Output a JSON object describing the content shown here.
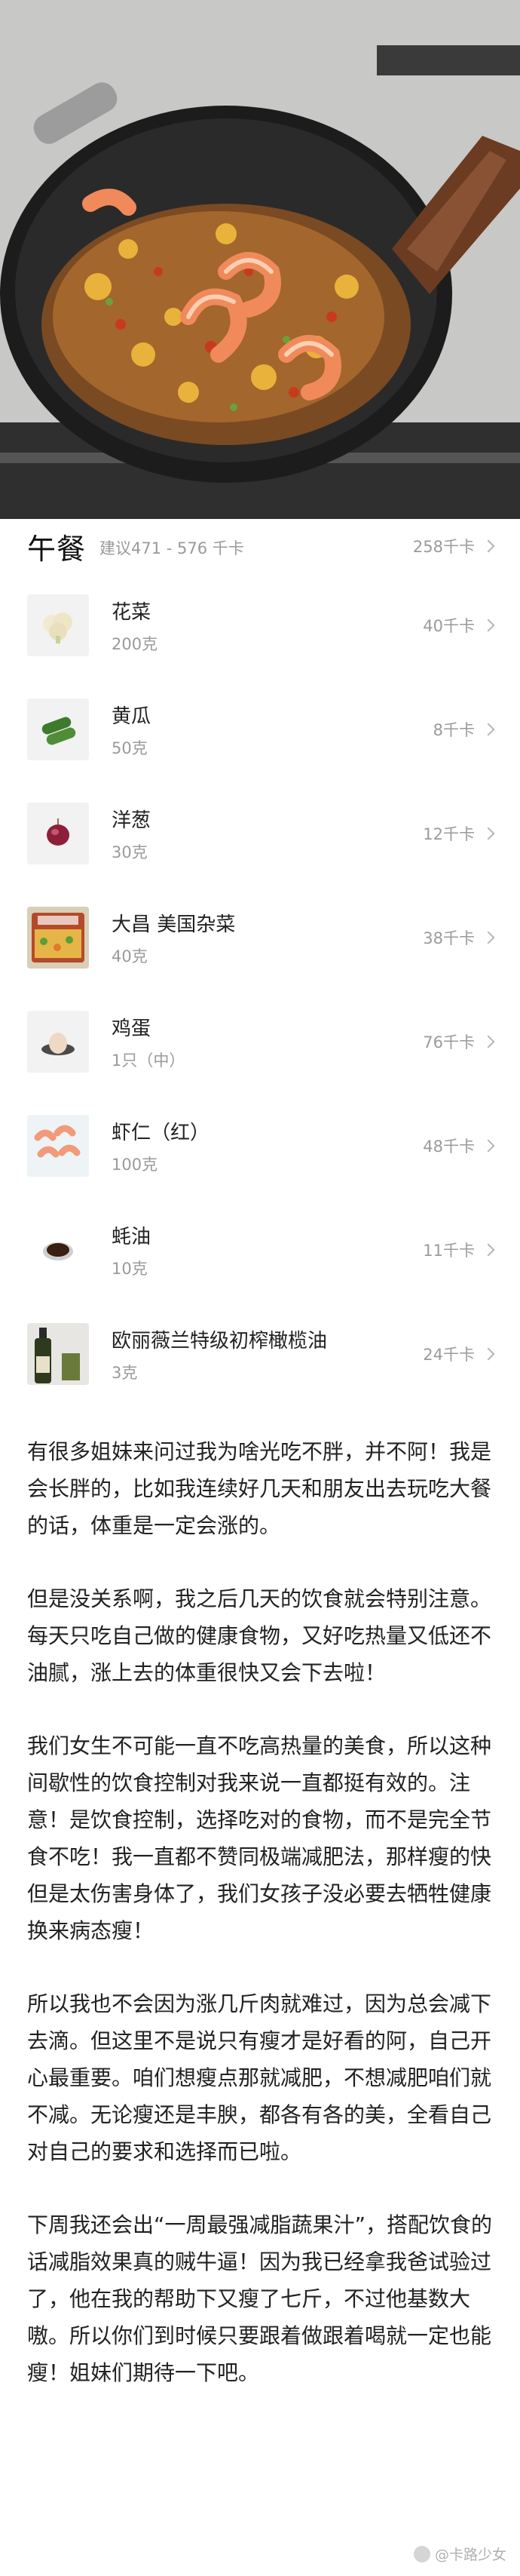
{
  "meal": {
    "title": "午餐",
    "suggestion": "建议471 - 576 千卡",
    "total": "258千卡"
  },
  "foods": [
    {
      "name": "花菜",
      "qty": "200克",
      "kcal": "40千卡",
      "icon": "cauliflower-icon"
    },
    {
      "name": "黄瓜",
      "qty": "50克",
      "kcal": "8千卡",
      "icon": "cucumber-icon"
    },
    {
      "name": "洋葱",
      "qty": "30克",
      "kcal": "12千卡",
      "icon": "onion-icon"
    },
    {
      "name": "大昌 美国杂菜",
      "qty": "40克",
      "kcal": "38千卡",
      "icon": "mixed-vegetables-icon"
    },
    {
      "name": "鸡蛋",
      "qty": "1只（中）",
      "kcal": "76千卡",
      "icon": "egg-icon"
    },
    {
      "name": "虾仁（红）",
      "qty": "100克",
      "kcal": "48千卡",
      "icon": "shrimp-icon"
    },
    {
      "name": "蚝油",
      "qty": "10克",
      "kcal": "11千卡",
      "icon": "oyster-sauce-icon"
    },
    {
      "name": "欧丽薇兰特级初榨橄榄油",
      "qty": "3克",
      "kcal": "24千卡",
      "icon": "olive-oil-icon"
    }
  ],
  "article": [
    "有很多姐妹来问过我为啥光吃不胖，并不阿！我是会长胖的，比如我连续好几天和朋友出去玩吃大餐的话，体重是一定会涨的。",
    "但是没关系啊，我之后几天的饮食就会特别注意。每天只吃自己做的健康食物，又好吃热量又低还不油腻，涨上去的体重很快又会下去啦！",
    "我们女生不可能一直不吃高热量的美食，所以这种间歇性的饮食控制对我来说一直都挺有效的。注意！是饮食控制，选择吃对的食物，而不是完全节食不吃！我一直都不赞同极端减肥法，那样瘦的快但是太伤害身体了，我们女孩子没必要去牺牲健康换来病态瘦！",
    "所以我也不会因为涨几斤肉就难过，因为总会减下去滴。但这里不是说只有瘦才是好看的阿，自己开心最重要。咱们想瘦点那就减肥，不想减肥咱们就不减。无论瘦还是丰腴，都各有各的美，全看自己对自己的要求和选择而已啦。",
    "下周我还会出“一周最强减脂蔬果汁”，搭配饮食的话减脂效果真的贼牛逼！因为我已经拿我爸试验过了，他在我的帮助下又瘦了七斤，不过他基数大嗷。所以你们到时候只要跟着做跟着喝就一定也能瘦！姐妹们期待一下吧。"
  ],
  "watermark": "@卡路少女"
}
